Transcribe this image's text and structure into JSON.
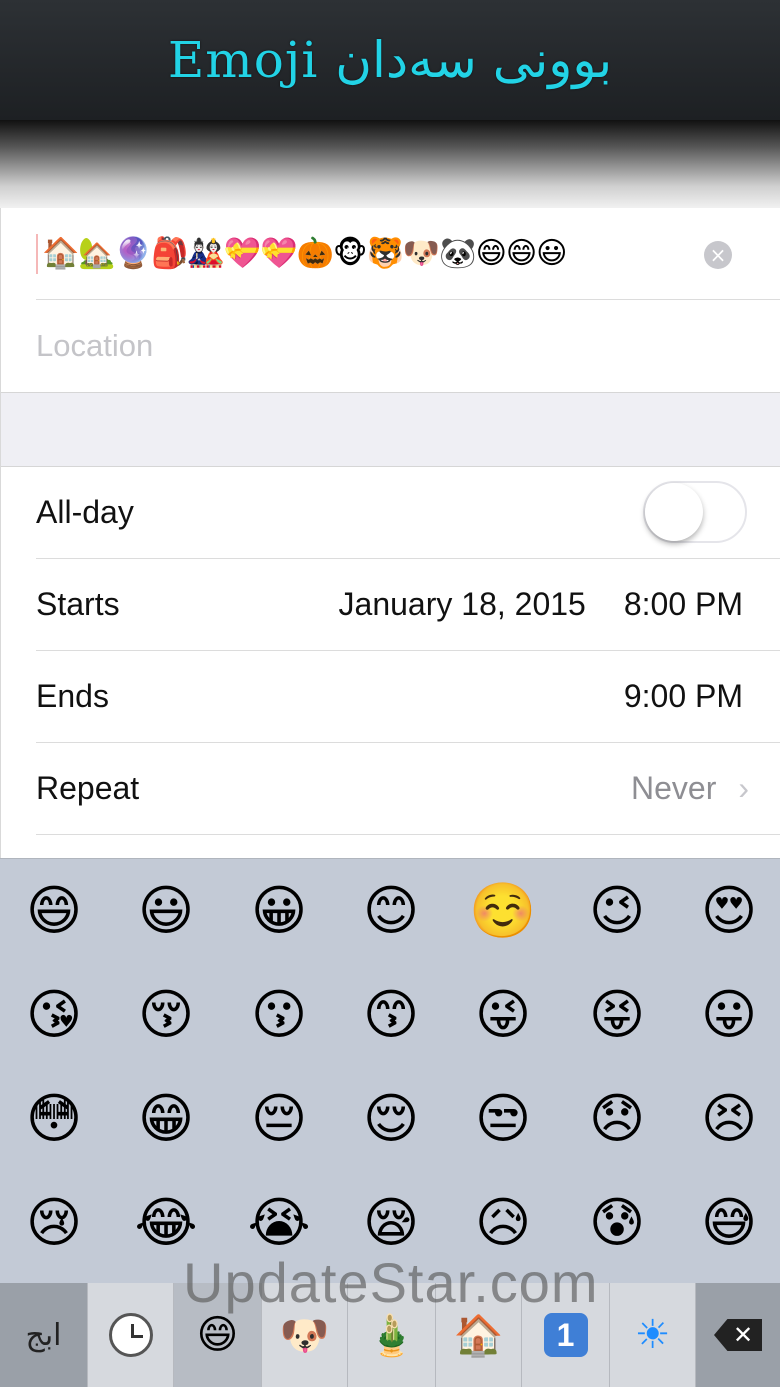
{
  "banner": {
    "title": "Emoji بوونی سەدان"
  },
  "event": {
    "title_value": "🏠🏡🔮🎒🎎💝💝🎃🐵🐯🐶🐼😄😄😃",
    "clear_label": "×",
    "location_placeholder": "Location"
  },
  "rows": {
    "allday": {
      "label": "All-day",
      "toggle_on": false
    },
    "starts": {
      "label": "Starts",
      "date": "January 18, 2015",
      "time": "8:00 PM"
    },
    "ends": {
      "label": "Ends",
      "time": "9:00 PM"
    },
    "repeat": {
      "label": "Repeat",
      "value": "Never",
      "chevron": "›"
    }
  },
  "keyboard": {
    "emojis": [
      [
        "😄",
        "😃",
        "😀",
        "😊",
        "☺️",
        "😉",
        "😍"
      ],
      [
        "😘",
        "😚",
        "😗",
        "😙",
        "😜",
        "😝",
        "😛"
      ],
      [
        "😳",
        "😁",
        "😔",
        "😌",
        "😒",
        "😞",
        "😣"
      ],
      [
        "😢",
        "😂",
        "😭",
        "😪",
        "😥",
        "😰",
        "😅"
      ]
    ],
    "tabs": {
      "abc_label": "ابج",
      "smileys": "😄",
      "nature": "🐶",
      "objects": "🎍",
      "places": "🏠",
      "symbols": "1",
      "symbols_sun": "☀",
      "delete": "✕"
    }
  },
  "watermark": "UpdateStar.com"
}
